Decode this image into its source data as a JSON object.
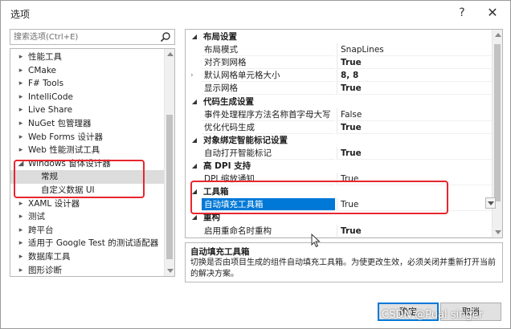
{
  "window": {
    "title": "选项",
    "help": "?",
    "close": "✕"
  },
  "search": {
    "placeholder": "搜索选项(Ctrl+E)"
  },
  "tree": {
    "items": [
      {
        "label": "性能工具",
        "expander": "▸"
      },
      {
        "label": "CMake",
        "expander": "▸"
      },
      {
        "label": "F# Tools",
        "expander": "▸"
      },
      {
        "label": "IntelliCode",
        "expander": "▸"
      },
      {
        "label": "Live Share",
        "expander": "▸"
      },
      {
        "label": "NuGet 包管理器",
        "expander": "▸"
      },
      {
        "label": "Web Forms 设计器",
        "expander": "▸"
      },
      {
        "label": "Web 性能测试工具",
        "expander": "▸"
      },
      {
        "label": "Windows 窗体设计器",
        "expander": "◢"
      },
      {
        "label": "常规",
        "expander": ""
      },
      {
        "label": "自定义数据 UI",
        "expander": ""
      },
      {
        "label": "XAML 设计器",
        "expander": "▸"
      },
      {
        "label": "测试",
        "expander": "▸"
      },
      {
        "label": "跨平台",
        "expander": "▸"
      },
      {
        "label": "适用于 Google Test 的测试适配器",
        "expander": "▸"
      },
      {
        "label": "数据库工具",
        "expander": "▸"
      },
      {
        "label": "图形诊断",
        "expander": "▸"
      }
    ]
  },
  "grid": {
    "rows": [
      {
        "kind": "cat",
        "toggle": "◢",
        "name": "布局设置"
      },
      {
        "kind": "prop",
        "name": "布局模式",
        "value": "SnapLines",
        "bold": false
      },
      {
        "kind": "prop",
        "name": "对齐到网格",
        "value": "True",
        "bold": true
      },
      {
        "kind": "prop",
        "name": "默认网格单元格大小",
        "value": "8, 8",
        "bold": true,
        "expander": "›"
      },
      {
        "kind": "prop",
        "name": "显示网格",
        "value": "True",
        "bold": true
      },
      {
        "kind": "cat",
        "toggle": "◢",
        "name": "代码生成设置"
      },
      {
        "kind": "prop",
        "name": "事件处理程序方法名称首字母大写",
        "value": "False",
        "bold": false
      },
      {
        "kind": "prop",
        "name": "优化代码生成",
        "value": "True",
        "bold": true
      },
      {
        "kind": "cat",
        "toggle": "◢",
        "name": "对象绑定智能标记设置"
      },
      {
        "kind": "prop",
        "name": "自动打开智能标记",
        "value": "True",
        "bold": true
      },
      {
        "kind": "cat",
        "toggle": "◢",
        "name": "高 DPI 支持"
      },
      {
        "kind": "prop",
        "name": "DPI 缩放通知",
        "value": "True",
        "bold": false
      },
      {
        "kind": "cat",
        "toggle": "◢",
        "name": "工具箱"
      },
      {
        "kind": "prop",
        "name": "自动填充工具箱",
        "value": "True",
        "bold": false,
        "selected": true
      },
      {
        "kind": "cat",
        "toggle": "◢",
        "name": "重构"
      },
      {
        "kind": "prop",
        "name": "启用重命名时重构",
        "value": "True",
        "bold": true
      }
    ]
  },
  "description": {
    "title": "自动填充工具箱",
    "text": "切换是否由项目生成的组件自动填充工具箱。为使更改生效，必须关闭并重新打开当前的解决方案。"
  },
  "buttons": {
    "ok": "确定",
    "cancel": "取消"
  },
  "watermark": "CSDN @Pual singer",
  "colors": {
    "selection": "#0078d7",
    "annotation": "#e8262d"
  }
}
